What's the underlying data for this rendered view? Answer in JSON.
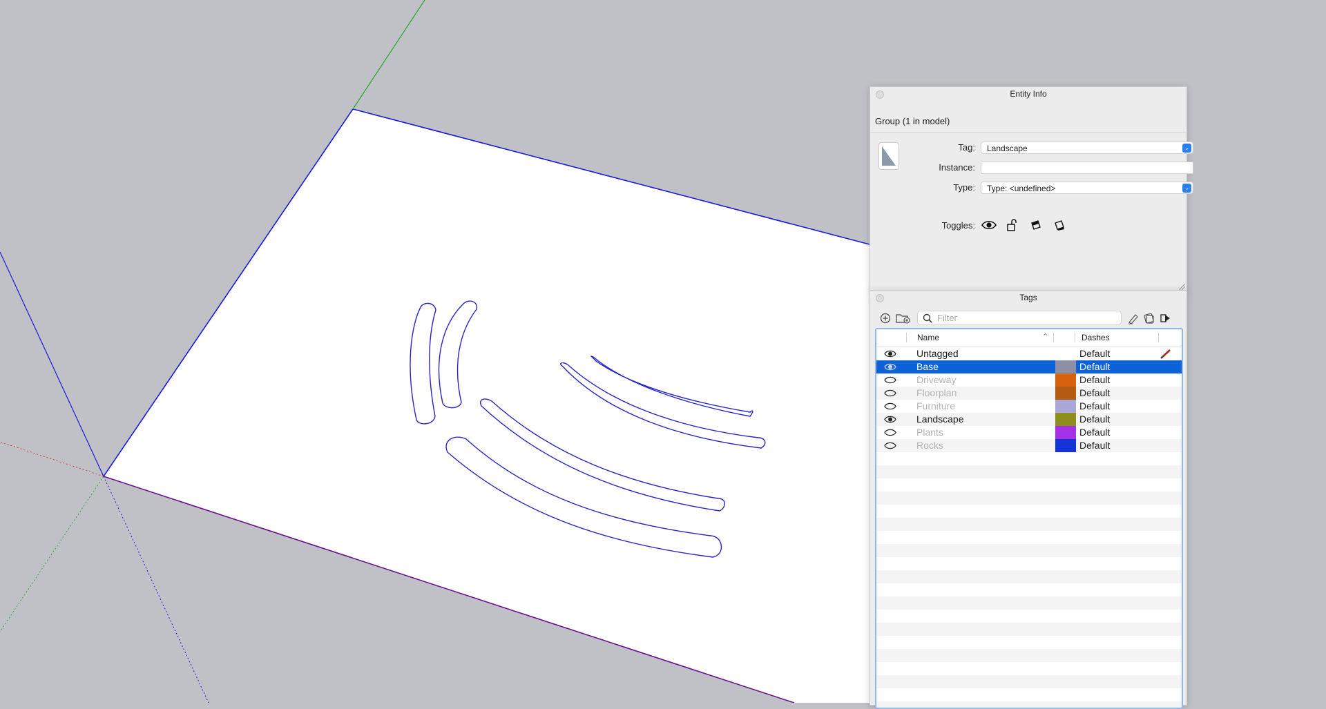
{
  "entity_info": {
    "title": "Entity Info",
    "group_line": "Group (1 in model)",
    "tag_label": "Tag:",
    "tag_value": "Landscape",
    "instance_label": "Instance:",
    "instance_value": "",
    "type_label": "Type:",
    "type_value": "Type: <undefined>",
    "toggles_label": "Toggles:",
    "toggle_icons": [
      "visible-eye-icon",
      "lock-icon",
      "receive-shadows-icon",
      "cast-shadows-icon"
    ]
  },
  "tags_panel": {
    "title": "Tags",
    "filter_placeholder": "Filter",
    "toolbar_icons": [
      "add-tag-icon",
      "add-folder-icon",
      "search-icon",
      "paint-icon",
      "color-by-tag-icon",
      "details-icon"
    ],
    "columns": {
      "name": "Name",
      "dashes": "Dashes"
    },
    "rows": [
      {
        "name": "Untagged",
        "visible": true,
        "color": "",
        "dashes": "Default",
        "selected": false,
        "active": true
      },
      {
        "name": "Base",
        "visible": true,
        "color": "#8d8fa6",
        "dashes": "Default",
        "selected": true,
        "active": false
      },
      {
        "name": "Driveway",
        "visible": false,
        "color": "#d86110",
        "dashes": "Default",
        "selected": false,
        "active": false
      },
      {
        "name": "Floorplan",
        "visible": false,
        "color": "#b35b13",
        "dashes": "Default",
        "selected": false,
        "active": false
      },
      {
        "name": "Furniture",
        "visible": false,
        "color": "#a9a8d8",
        "dashes": "Default",
        "selected": false,
        "active": false
      },
      {
        "name": "Landscape",
        "visible": true,
        "color": "#8f8e1e",
        "dashes": "Default",
        "selected": false,
        "active": false
      },
      {
        "name": "Plants",
        "visible": false,
        "color": "#a431e6",
        "dashes": "Default",
        "selected": false,
        "active": false
      },
      {
        "name": "Rocks",
        "visible": false,
        "color": "#1533d6",
        "dashes": "Default",
        "selected": false,
        "active": false
      }
    ]
  },
  "colors": {
    "viewport_bg": "#c0c1c7",
    "edge_blue": "#1a1ad6",
    "selection_blue": "#0c62d6",
    "axis_green": "#2aa52a",
    "axis_red": "#d33a3a",
    "edge_purple": "#6b0f95"
  }
}
